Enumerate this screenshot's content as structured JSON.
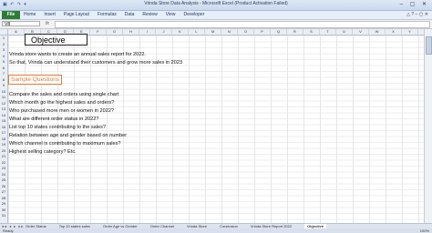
{
  "window": {
    "title": "Vrinda Store Data Analysis - Microsoft Excel (Product Activation Failed)"
  },
  "ribbon": {
    "file_label": "File",
    "tabs": [
      "Home",
      "Insert",
      "Page Layout",
      "Formulas",
      "Data",
      "Review",
      "View",
      "Developer"
    ]
  },
  "formula_bar": {
    "name_box": "V8",
    "fx": "fx",
    "value": ""
  },
  "columns": [
    "A",
    "B",
    "C",
    "D",
    "E",
    "F",
    "G",
    "H",
    "I",
    "J",
    "K",
    "L",
    "M",
    "N",
    "O",
    "P",
    "Q",
    "R",
    "S",
    "T",
    "U",
    "V",
    "W",
    "X",
    "Y",
    "Z"
  ],
  "rows": [
    "1",
    "2",
    "3",
    "4",
    "5",
    "6",
    "7",
    "8",
    "9",
    "10",
    "11",
    "12",
    "13",
    "14",
    "15",
    "16",
    "17",
    "18",
    "19",
    "20",
    "21",
    "22",
    "23",
    "24",
    "25",
    "26",
    "27",
    "28",
    "29",
    "30",
    "31"
  ],
  "sheet": {
    "objective_title": "Objective",
    "objective_lines": [
      "Vrinda store wants to create an annual sales report for 2022.",
      "So that, Vrinda can understand their customers and grow more sales in 2023"
    ],
    "questions_title": "Sample Questions",
    "questions": [
      "Compare the sales and orders using single chart",
      "Which month go the highest sales and orders?",
      "Who purchased more men or women in 2022?",
      "What are different order status in 2022?",
      "List top 10 states contributing to the sales?",
      "Relation between age and gender based on number",
      "Which channel is contributing to maximum sales?",
      "Highest selling category? Etc."
    ]
  },
  "sheet_tabs": {
    "items": [
      "Order Status",
      "Top 10 states sales",
      "Order Age vs Gender",
      "Order Channel",
      "Vrinda Store",
      "Conclusion",
      "Vrinda Store Report 2022",
      "Objective"
    ],
    "active": "Objective"
  },
  "status": {
    "ready": "Ready",
    "zoom": "100%"
  }
}
